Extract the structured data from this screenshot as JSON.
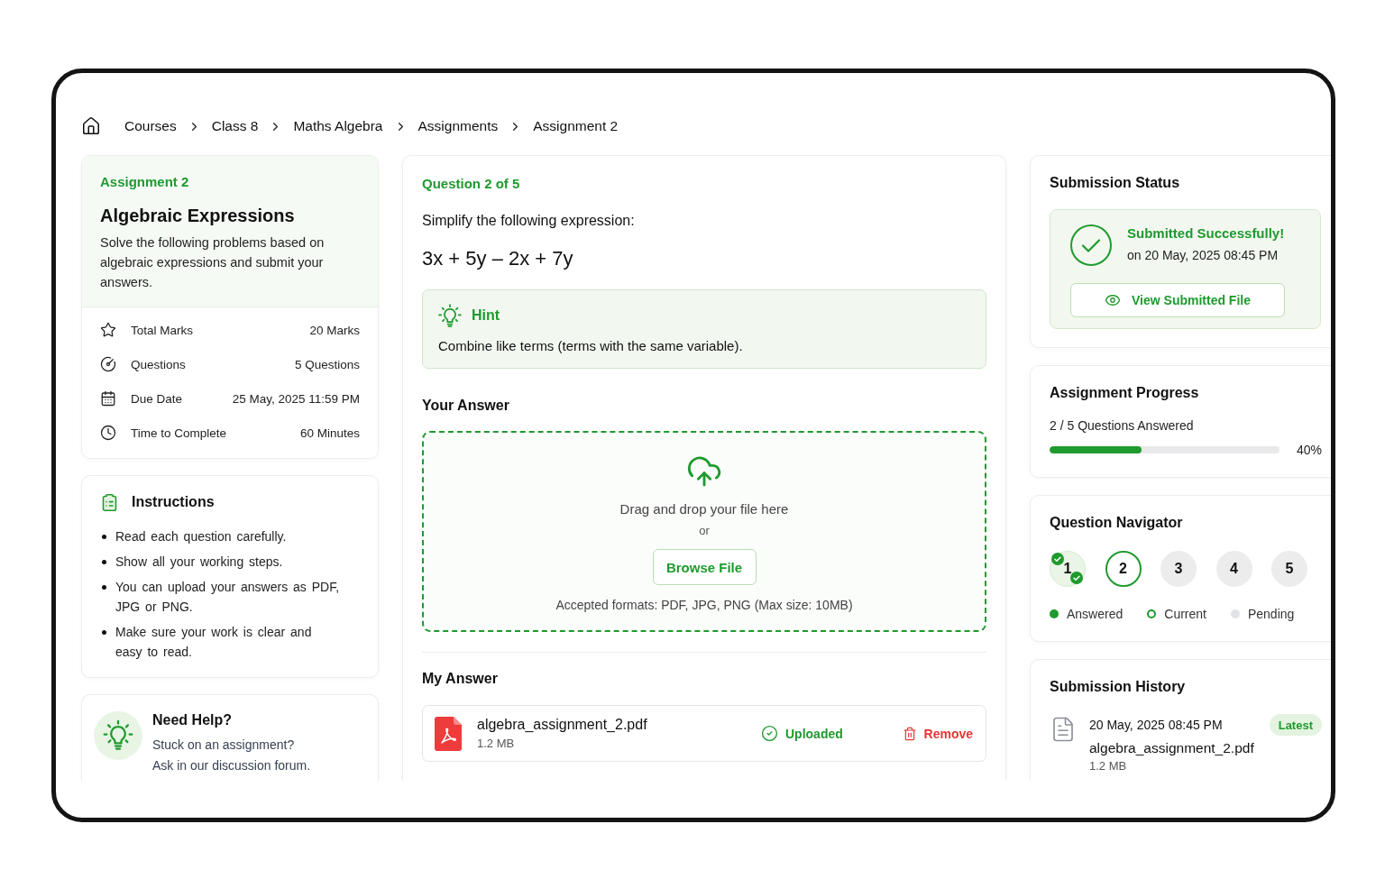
{
  "breadcrumb": [
    "Courses",
    "Class 8",
    "Maths Algebra",
    "Assignments",
    "Assignment 2"
  ],
  "assignment": {
    "label": "Assignment 2",
    "title": "Algebraic Expressions",
    "description": "Solve the following problems based on algebraic expressions and submit your answers.",
    "details": [
      {
        "label": "Total Marks",
        "value": "20 Marks"
      },
      {
        "label": "Questions",
        "value": "5 Questions"
      },
      {
        "label": "Due Date",
        "value": "25 May, 2025 11:59 PM"
      },
      {
        "label": "Time to Complete",
        "value": "60 Minutes"
      }
    ]
  },
  "instructions": {
    "title": "Instructions",
    "items": [
      "Read each question carefully.",
      "Show all your working steps.",
      "You can upload your answers as PDF, JPG or PNG.",
      "Make sure your work is clear and easy to read."
    ]
  },
  "help": {
    "title": "Need Help?",
    "lines": [
      "Stuck on an assignment?",
      "Ask in our discussion forum."
    ]
  },
  "question": {
    "counter": "Question 2 of 5",
    "prompt": "Simplify the following expression:",
    "expression": "3x + 5y – 2x + 7y",
    "hint": {
      "title": "Hint",
      "text": "Combine like terms (terms with the same variable)."
    }
  },
  "answer_upload": {
    "title": "Your Answer",
    "drop_text": "Drag and drop your file here",
    "separator": "or",
    "button": "Browse File",
    "formats": "Accepted formats: PDF, JPG, PNG (Max size: 10MB)"
  },
  "my_answer": {
    "title": "My Answer",
    "file": {
      "name": "algebra_assignment_2.pdf",
      "size": "1.2 MB",
      "status": "Uploaded",
      "action": "Remove"
    }
  },
  "submission_status": {
    "title": "Submission Status",
    "message": "Submitted Successfully!",
    "date": "on 20 May, 2025 08:45 PM",
    "button": "View Submitted File"
  },
  "progress": {
    "title": "Assignment Progress",
    "text": "2 / 5 Questions Answered",
    "level": 0.4,
    "reading": "40%"
  },
  "navigator": {
    "title": "Question Navigator",
    "questions": [
      {
        "label": "1",
        "answered": true,
        "selected": false
      },
      {
        "label": "2",
        "answered": false,
        "selected": true
      },
      {
        "label": "3",
        "answered": false,
        "selected": false
      },
      {
        "label": "4",
        "answered": false,
        "selected": false
      },
      {
        "label": "5",
        "answered": false,
        "selected": false
      }
    ],
    "legend": [
      {
        "kind": "answered",
        "label": "Answered"
      },
      {
        "kind": "current",
        "label": "Current"
      },
      {
        "kind": "pending",
        "label": "Pending"
      }
    ]
  },
  "history": {
    "title": "Submission History",
    "entries": [
      {
        "date": "20 May, 2025 08:45 PM",
        "badge": "Latest",
        "file": "algebra_assignment_2.pdf",
        "size": "1.2 MB"
      }
    ]
  }
}
